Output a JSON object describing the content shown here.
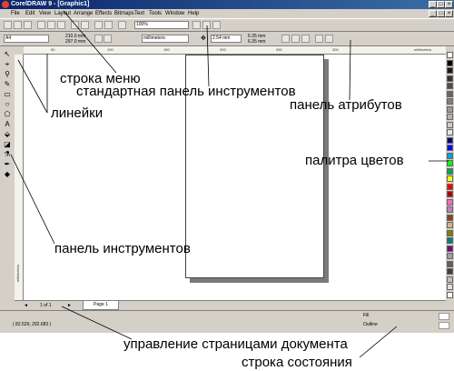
{
  "window": {
    "title": "CorelDRAW 9 - [Graphic1]"
  },
  "menu": [
    "File",
    "Edit",
    "View",
    "Layout",
    "Arrange",
    "Effects",
    "Bitmaps",
    "Text",
    "Tools",
    "Window",
    "Help"
  ],
  "standard_toolbar": {
    "zoom": "100%"
  },
  "property_bar": {
    "paper": "A4",
    "width": "210.0 mm",
    "height": "297.0 mm",
    "units": "millimeters",
    "nudge": "2.54 mm",
    "dup_x": "6.35 mm",
    "dup_y": "6.35 mm"
  },
  "ruler": {
    "unit": "millimeters",
    "h_ticks": [
      "50",
      "100",
      "150",
      "200",
      "250",
      "300"
    ]
  },
  "page_nav": {
    "counter": "1 of 1",
    "tab": "Page 1"
  },
  "status": {
    "coords": "( 82.526; 292.683 )",
    "fill": "Fill",
    "outline": "Outline"
  },
  "annotations": {
    "menu": "строка меню",
    "standard": "стандартная панель инструментов",
    "rulers": "линейки",
    "attributes": "панель атрибутов",
    "palette": "палитра цветов",
    "toolbox": "панель инструментов",
    "page_control": "управление страницами документа",
    "status_bar": "строка состояния"
  },
  "palette_colors": [
    "#ffffff",
    "#000000",
    "#1a1a1a",
    "#333333",
    "#4d4d4d",
    "#666666",
    "#808080",
    "#999999",
    "#b3b3b3",
    "#cccccc",
    "#e6e6e6",
    "#000080",
    "#0000ff",
    "#00a0e0",
    "#00ff00",
    "#00a651",
    "#ffff00",
    "#ff0000",
    "#b00000",
    "#ff66cc",
    "#c080c0",
    "#8b4513",
    "#d2b48c",
    "#808000",
    "#008080",
    "#800080",
    "#a0a0a0",
    "#606060",
    "#404040",
    "#c0c0c0",
    "#e0e0e0",
    "#ffffff"
  ]
}
